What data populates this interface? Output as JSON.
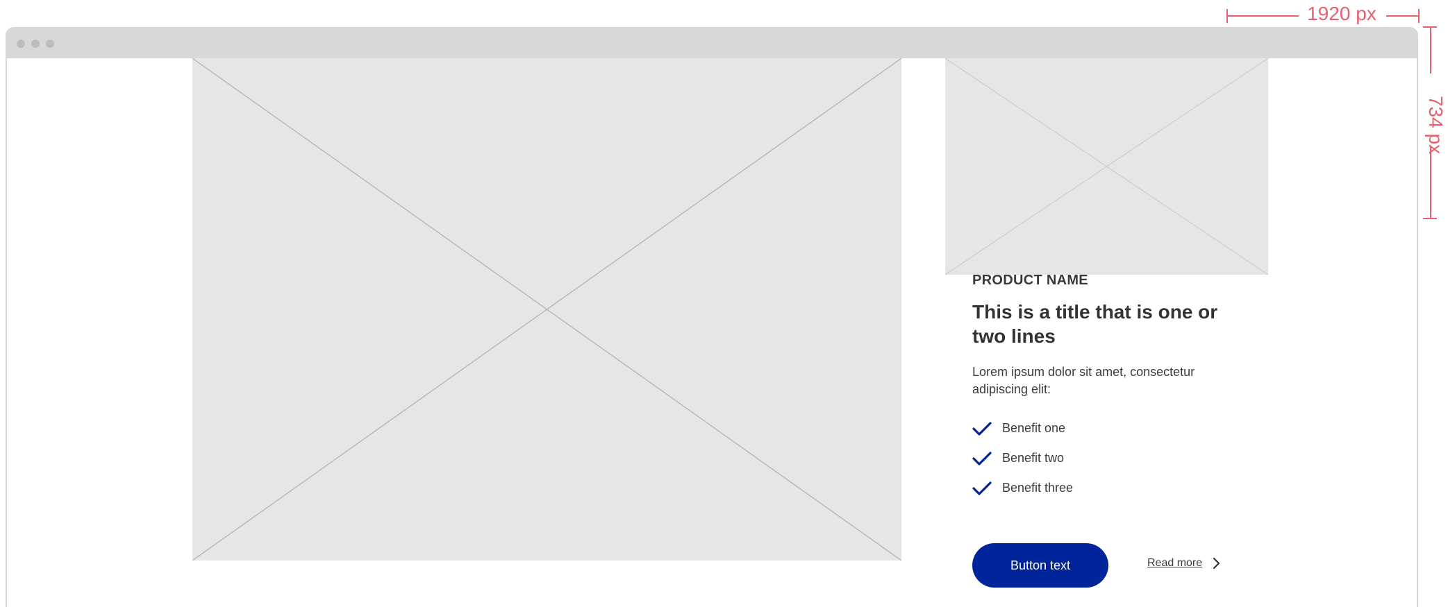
{
  "annotations": {
    "width_label": "1920 px",
    "height_label": "734 px"
  },
  "product": {
    "name": "PRODUCT NAME",
    "title": "This is a title that is one or two lines",
    "intro": "Lorem ipsum dolor sit amet, consectetur adipiscing elit:",
    "benefits": [
      "Benefit one",
      "Benefit two",
      "Benefit three"
    ]
  },
  "cta": {
    "button_label": "Button text",
    "link_label": "Read more"
  },
  "colors": {
    "accent": "#00259a",
    "annotation": "#e8606e",
    "placeholder": "#e6e6e6",
    "browser_bar": "#d8d8d8"
  },
  "icons": {
    "benefit": "check-icon",
    "read_more": "chevron-right-icon",
    "image_placeholder": "image-placeholder-icon"
  }
}
